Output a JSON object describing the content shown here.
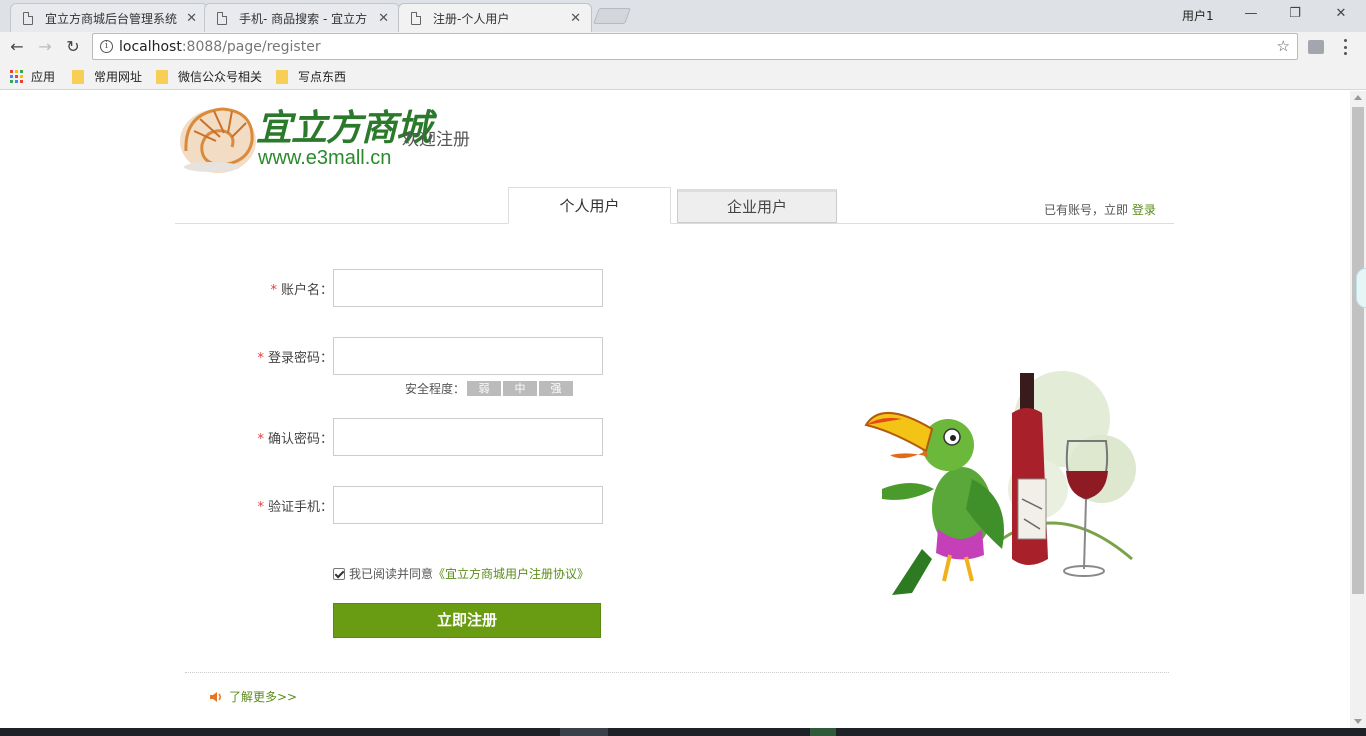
{
  "browser": {
    "tabs": [
      {
        "title": "宜立方商城后台管理系统",
        "close": "✕"
      },
      {
        "title": "手机- 商品搜索 - 宜立方",
        "close": "✕"
      },
      {
        "title": "注册-个人用户",
        "close": "✕"
      }
    ],
    "window_user": "用户1",
    "url_host": "localhost",
    "url_rest": ":8088/page/register",
    "bookmarks": [
      "应用",
      "常用网址",
      "微信公众号相关",
      "写点东西"
    ]
  },
  "header": {
    "logo_text": "宜立方商城",
    "logo_url": "www.e3mall.cn",
    "welcome": "欢迎注册"
  },
  "reg_tabs": {
    "personal": "个人用户",
    "enterprise": "企业用户"
  },
  "account_hint": {
    "text": "已有账号，立即",
    "login": "登录"
  },
  "form": {
    "required_mark": "*",
    "username_label": "账户名：",
    "password_label": "登录密码：",
    "confirm_label": "确认密码：",
    "phone_label": "验证手机：",
    "strength_label": "安全程度：",
    "strength_levels": [
      "弱",
      "中",
      "强"
    ],
    "agree_text": "我已阅读并同意",
    "agree_link": "《宜立方商城用户注册协议》",
    "submit": "立即注册"
  },
  "footer": {
    "more": "了解更多>>"
  },
  "colors": {
    "brand_green": "#6a9c13",
    "link_green": "#5a8c1a",
    "required_red": "#e4393c"
  }
}
